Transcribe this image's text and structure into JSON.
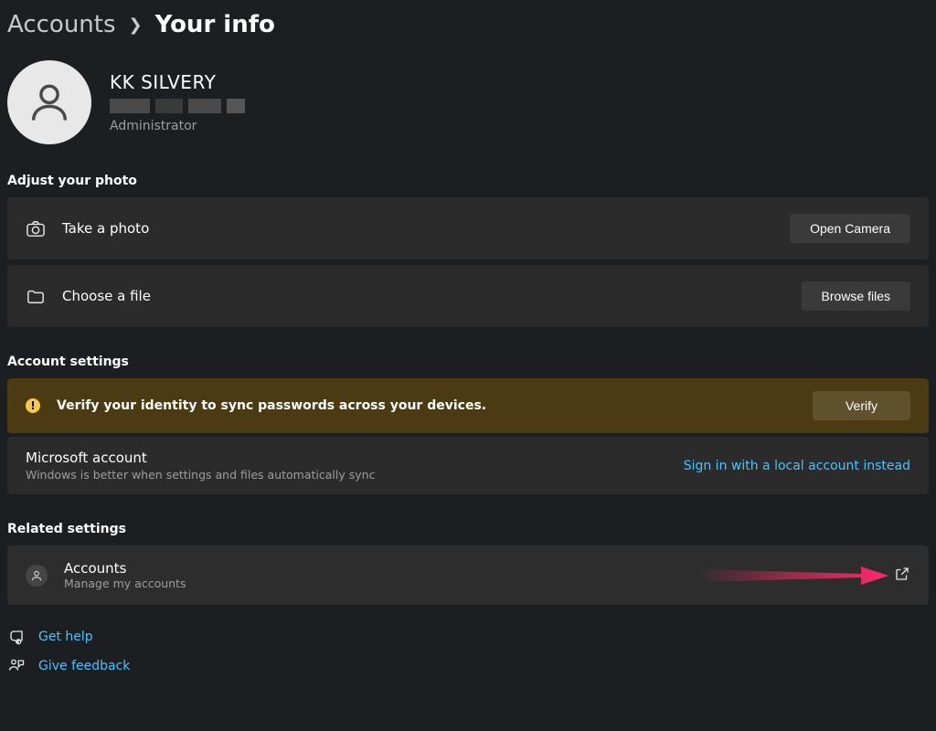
{
  "breadcrumb": {
    "parent": "Accounts",
    "current": "Your info"
  },
  "profile": {
    "name": "KK SILVERY",
    "role": "Administrator"
  },
  "sections": {
    "photo_title": "Adjust your photo",
    "account_title": "Account settings",
    "related_title": "Related settings"
  },
  "photo": {
    "take_label": "Take a photo",
    "take_button": "Open Camera",
    "choose_label": "Choose a file",
    "choose_button": "Browse files"
  },
  "account": {
    "verify_msg": "Verify your identity to sync passwords across your devices.",
    "verify_button": "Verify",
    "ms_title": "Microsoft account",
    "ms_sub": "Windows is better when settings and files automatically sync",
    "local_link": "Sign in with a local account instead"
  },
  "related": {
    "accounts_title": "Accounts",
    "accounts_sub": "Manage my accounts"
  },
  "footer": {
    "help": "Get help",
    "feedback": "Give feedback"
  }
}
